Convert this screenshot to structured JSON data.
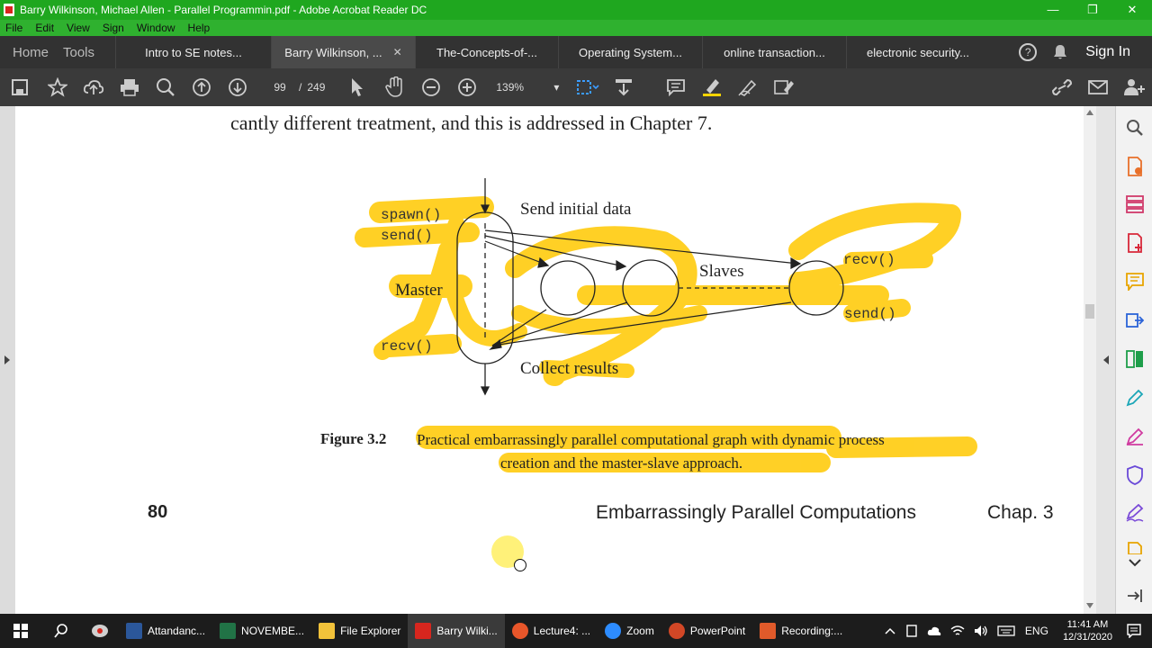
{
  "window": {
    "title": "Barry Wilkinson, Michael Allen - Parallel Programmin.pdf - Adobe Acrobat Reader DC",
    "minimize": "—",
    "restore": "❐",
    "close": "✕"
  },
  "menu": [
    "File",
    "Edit",
    "View",
    "Sign",
    "Window",
    "Help"
  ],
  "tabs": {
    "home": "Home",
    "tools": "Tools",
    "documents": [
      {
        "label": "Intro to SE notes..."
      },
      {
        "label": "Barry Wilkinson, ...",
        "active": true
      },
      {
        "label": "The-Concepts-of-..."
      },
      {
        "label": "Operating System..."
      },
      {
        "label": "online transaction..."
      },
      {
        "label": "electronic security..."
      }
    ],
    "close_glyph": "✕",
    "help": "?",
    "sign_in": "Sign In"
  },
  "toolbar": {
    "current_page": "99",
    "page_separator": "/",
    "total_pages": "249",
    "zoom": "139%",
    "zoom_caret": "▾"
  },
  "document": {
    "top_text": "cantly different treatment, and this is addressed in Chapter 7.",
    "diagram": {
      "spawn": "spawn()",
      "send_left": "send()",
      "master": "Master",
      "recv_left": "recv()",
      "send_initial": "Send initial data",
      "slaves": "Slaves",
      "recv_right": "recv()",
      "send_right": "send()",
      "collect": "Collect results"
    },
    "figure_label": "Figure 3.2",
    "caption_line1": "Practical embarrassingly parallel computational graph with dynamic process",
    "caption_line2": "creation and the master-slave approach.",
    "page_number": "80",
    "running_title": "Embarrassingly Parallel Computations",
    "chapter": "Chap. 3"
  },
  "taskbar": {
    "items": [
      {
        "label": "Attandanc...",
        "color": "#2b579a"
      },
      {
        "label": "NOVEMBE...",
        "color": "#217346"
      },
      {
        "label": "File Explorer",
        "color": "#f2c23a"
      },
      {
        "label": "Barry Wilki...",
        "color": "#d7261e",
        "active": true
      },
      {
        "label": "Lecture4: ...",
        "color": "#e8562a"
      },
      {
        "label": "Zoom",
        "color": "#2d8cff"
      },
      {
        "label": "PowerPoint",
        "color": "#d24726"
      },
      {
        "label": "Recording:...",
        "color": "#e05a2a"
      }
    ],
    "lang": "ENG",
    "time": "11:41 AM",
    "date": "12/31/2020"
  },
  "colors": {
    "titlebar": "#1fa71f",
    "highlight": "#ffc800"
  }
}
